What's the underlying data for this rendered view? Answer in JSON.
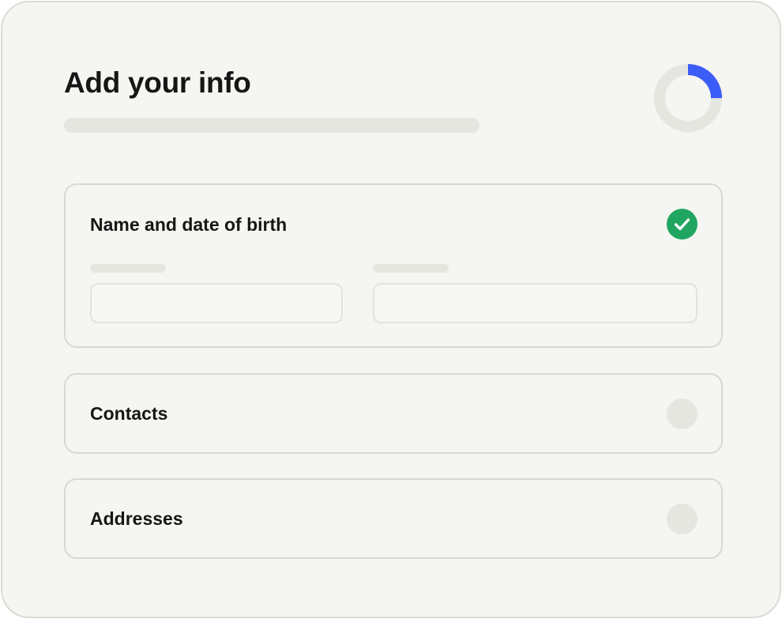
{
  "header": {
    "title": "Add your info"
  },
  "progress": {
    "fraction": 0.25,
    "track_color": "#e6e6e0",
    "fill_color": "#3b5cf6"
  },
  "sections": [
    {
      "title": "Name and date of birth",
      "status": "complete",
      "status_icon": "checkmark-circle-icon",
      "status_color": "#20a661"
    },
    {
      "title": "Contacts",
      "status": "pending"
    },
    {
      "title": "Addresses",
      "status": "pending"
    }
  ]
}
